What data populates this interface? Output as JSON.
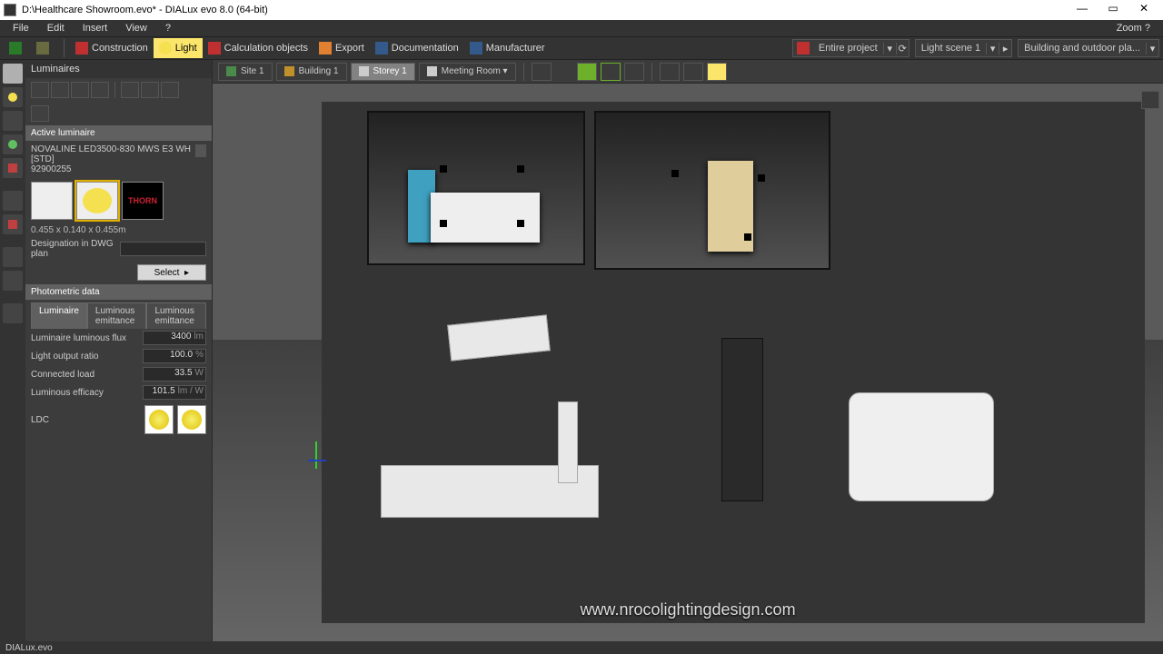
{
  "titlebar": {
    "title": "D:\\Healthcare Showroom.evo* - DIALux evo 8.0   (64-bit)"
  },
  "menu": {
    "items": [
      "File",
      "Edit",
      "Insert",
      "View",
      "?"
    ],
    "right": "Zoom ?"
  },
  "toolbar": {
    "construction": "Construction",
    "light": "Light",
    "calc": "Calculation objects",
    "export": "Export",
    "documentation": "Documentation",
    "manufacturer": "Manufacturer",
    "entire_project": "Entire project",
    "light_scene": "Light scene 1",
    "view_mode": "Building and outdoor pla..."
  },
  "breadcrumbs": {
    "site": "Site 1",
    "building": "Building 1",
    "storey": "Storey 1",
    "room": "Meeting Room"
  },
  "panel": {
    "title": "Luminaires",
    "section_active": "Active luminaire",
    "luminaire_name": "NOVALINE LED3500-830 MWS E3 WH [STD]",
    "luminaire_code": "92900255",
    "logo": "THORN",
    "dims": "0.455 x 0.140 x 0.455m",
    "dwg_label": "Designation in DWG plan",
    "select_btn": "Select",
    "section_photo": "Photometric data",
    "tabs": [
      "Luminaire",
      "Luminous emittance",
      "Luminous emittance"
    ],
    "photometric": [
      {
        "label": "Luminaire luminous flux",
        "val": "3400",
        "unit": "lm"
      },
      {
        "label": "Light output ratio",
        "val": "100.0",
        "unit": "%"
      },
      {
        "label": "Connected load",
        "val": "33.5",
        "unit": "W"
      },
      {
        "label": "Luminous efficacy",
        "val": "101.5",
        "unit": "lm / W"
      }
    ],
    "ldc_label": "LDC"
  },
  "render": {
    "watermark": "www.nrocolightingdesign.com"
  },
  "status": {
    "text": "DIALux.evo"
  }
}
